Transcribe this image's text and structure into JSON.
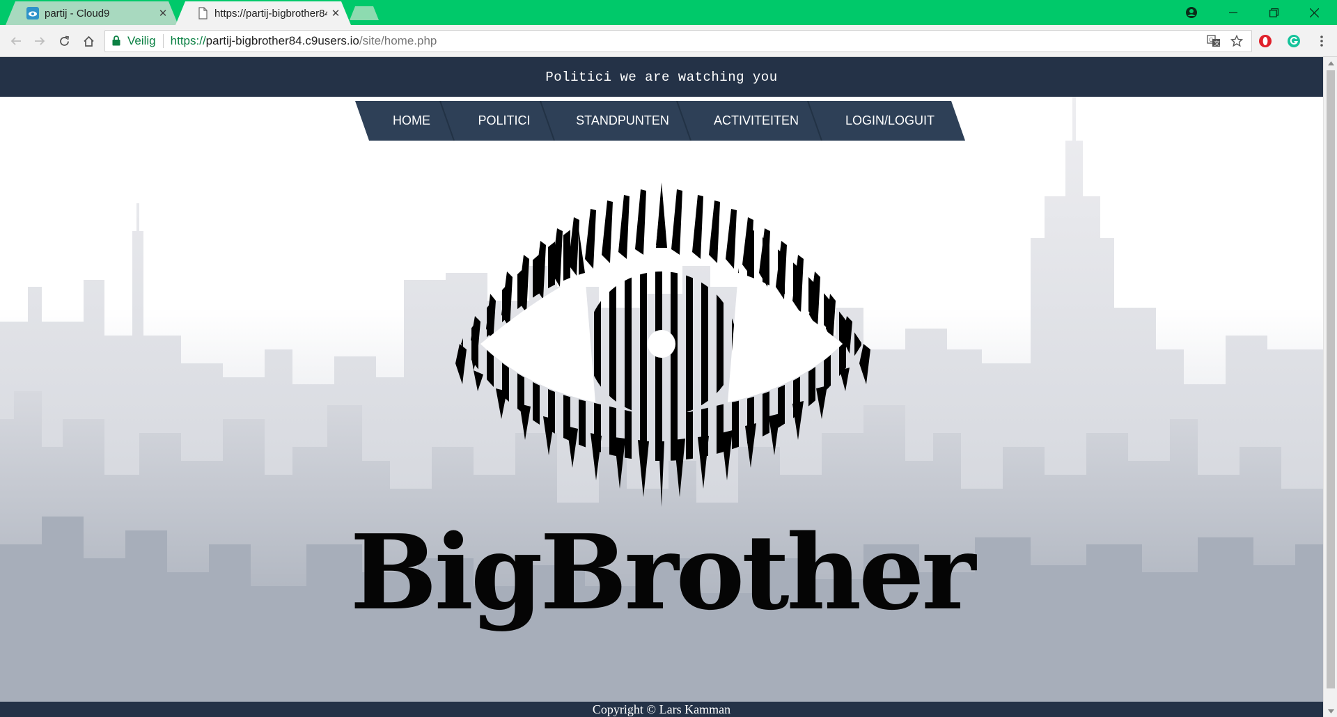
{
  "browser": {
    "tabs": [
      {
        "title": "partij - Cloud9",
        "favicon": "cloud9-icon",
        "active": false
      },
      {
        "title": "https://partij-bigbrother84.c9users.io/site/home.php",
        "favicon": "page-icon",
        "active": true
      }
    ],
    "address": {
      "secure_label": "Veilig",
      "scheme": "https://",
      "host": "partij-bigbrother84.c9users.io",
      "path": "/site/home.php"
    },
    "colors": {
      "tabstrip": "#00c96a",
      "secure_green": "#0b8043"
    }
  },
  "site": {
    "header_text": "Politici we are watching you",
    "nav": {
      "items": [
        {
          "label": "HOME"
        },
        {
          "label": "POLITICI"
        },
        {
          "label": "STANDPUNTEN"
        },
        {
          "label": "ACTIVITEITEN"
        },
        {
          "label": "LOGIN/LOGUIT"
        }
      ]
    },
    "brand": {
      "wordmark": "BigBrother"
    },
    "footer_text": "Copyright © Lars Kamman",
    "colors": {
      "header_bg": "#243247",
      "nav_bg": "#2e4057",
      "text_dark": "#050505"
    }
  }
}
